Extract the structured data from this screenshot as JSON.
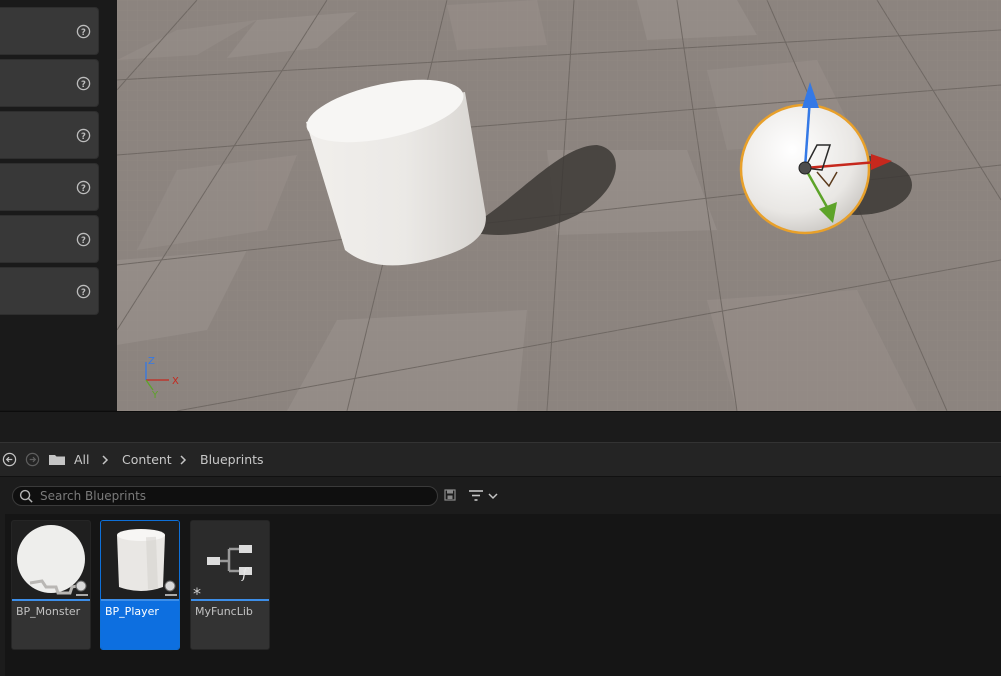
{
  "content_browser": {
    "breadcrumb": [
      "All",
      "Content",
      "Blueprints"
    ],
    "search": {
      "placeholder": "Search Blueprints",
      "value": ""
    },
    "assets": [
      {
        "name": "BP_Monster",
        "thumbnail": "sphere",
        "selected": false
      },
      {
        "name": "BP_Player",
        "thumbnail": "cylinder",
        "selected": true
      },
      {
        "name": "MyFuncLib",
        "thumbnail": "function-library",
        "selected": false
      }
    ]
  },
  "viewport": {
    "axis_labels": {
      "z": "Z",
      "x": "X",
      "y": "Y"
    }
  },
  "colors": {
    "selection_blue": "#0d6fe0",
    "gizmo_x": "#c6281d",
    "gizmo_y": "#5da329",
    "gizmo_z": "#3479e6",
    "selection_outline": "#e8a02a"
  },
  "icons": {
    "details_rows": "help-icon",
    "nav": [
      "back-arrow-icon",
      "forward-arrow-icon",
      "folder-icon"
    ],
    "toolbar": [
      "search-icon",
      "save-search-icon",
      "filter-icon"
    ]
  }
}
